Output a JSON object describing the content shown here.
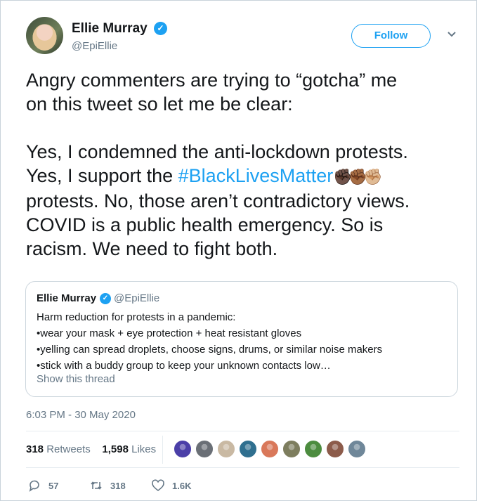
{
  "author": {
    "name": "Ellie Murray",
    "handle": "@EpiEllie",
    "verified_icon": "verified-badge-icon"
  },
  "follow_label": "Follow",
  "tweet": {
    "lines_1": [
      "Angry commenters are trying to “gotcha” me",
      "on this tweet so let me be clear:"
    ],
    "line_yes1": "Yes, I condemned the anti-lockdown protests.",
    "line_yes2_prefix": "Yes, I support the ",
    "hashtag": "#BlackLivesMatter",
    "emoji": "✊🏿✊🏾✊🏼",
    "lines_2": [
      "protests. No, those aren’t contradictory views.",
      "COVID is a public health emergency. So is",
      "racism. We need to fight both."
    ]
  },
  "quote": {
    "name": "Ellie Murray",
    "handle": "@EpiEllie",
    "lines": [
      "Harm reduction for protests in a pandemic:",
      "•wear your mask + eye protection + heat resistant gloves",
      "•yelling can spread droplets, choose signs, drums, or similar noise makers",
      "•stick with a buddy group to keep your unknown contacts low…"
    ],
    "show_thread": "Show this thread"
  },
  "timestamp": "6:03 PM - 30 May 2020",
  "stats": {
    "retweets_count": "318",
    "retweets_label": "Retweets",
    "likes_count": "1,598",
    "likes_label": "Likes"
  },
  "likers": [
    {
      "color": "#4b3fa8"
    },
    {
      "color": "#6a6f76"
    },
    {
      "color": "#c9b9a3"
    },
    {
      "color": "#2f6f8f"
    },
    {
      "color": "#d9785a"
    },
    {
      "color": "#7d7d5e"
    },
    {
      "color": "#4c8c3f"
    },
    {
      "color": "#8c5b4a"
    },
    {
      "color": "#6f8799"
    }
  ],
  "actions": {
    "replies": "57",
    "retweets": "318",
    "likes": "1.6K"
  },
  "colors": {
    "accent": "#1da1f2",
    "text": "#14171a",
    "muted": "#657786"
  }
}
